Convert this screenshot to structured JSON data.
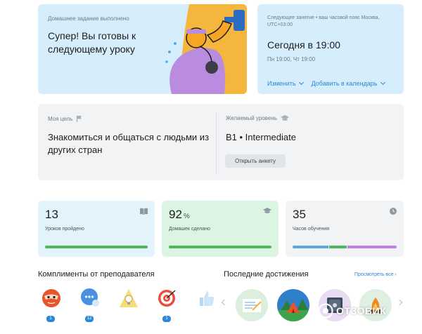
{
  "homework": {
    "status": "Домашнее задание выполнено",
    "message": "Супер! Вы готовы к следующему уроку"
  },
  "next_lesson": {
    "note": "Следующее занятие • ваш часовой пояс Москва, UTC+03:00",
    "when": "Сегодня в 19:00",
    "days": "Пн 19:00, Чт 19:00",
    "change_label": "Изменить",
    "add_calendar_label": "Добавить в календарь"
  },
  "goal": {
    "goal_label": "Моя цель",
    "goal_text": "Знакомиться и общаться с людьми из других стран",
    "level_label": "Желаемый уровень",
    "level_value": "B1 • Intermediate",
    "open_form_label": "Открыть анкету"
  },
  "stats": [
    {
      "value": "13",
      "suffix": "",
      "label": "Уроков пройдено",
      "icon": "book-icon",
      "progress_color": "#4fb85c"
    },
    {
      "value": "92",
      "suffix": "%",
      "label": "Домашек сделано",
      "icon": "graduation-cap-icon",
      "progress_color": "#4fb85c"
    },
    {
      "value": "35",
      "suffix": "",
      "label": "Часов обучения",
      "icon": "clock-icon"
    }
  ],
  "hours_bar_segments": [
    {
      "fraction": 0.35,
      "color": "#5aa9e6"
    },
    {
      "fraction": 0.17,
      "color": "#4fb85c"
    },
    {
      "fraction": 0.48,
      "color": "#c07fe0"
    }
  ],
  "compliments": {
    "title": "Комплименты от преподавателя",
    "items": [
      {
        "icon": "superhero-mask-icon",
        "count": "1"
      },
      {
        "icon": "speech-bubble-icon",
        "count": "12"
      },
      {
        "icon": "lightbulb-icon",
        "count": ""
      },
      {
        "icon": "target-icon",
        "count": "1"
      },
      {
        "icon": "thumbs-up-icon",
        "count": ""
      }
    ]
  },
  "achievements": {
    "title": "Последние достижения",
    "see_all": "Просмотреть все ›",
    "items": [
      {
        "icon": "notebook-icon"
      },
      {
        "icon": "camping-tent-icon"
      },
      {
        "icon": "safe-icon"
      },
      {
        "icon": "campfire-icon"
      }
    ]
  },
  "watermark": "ОТЗОВИК"
}
